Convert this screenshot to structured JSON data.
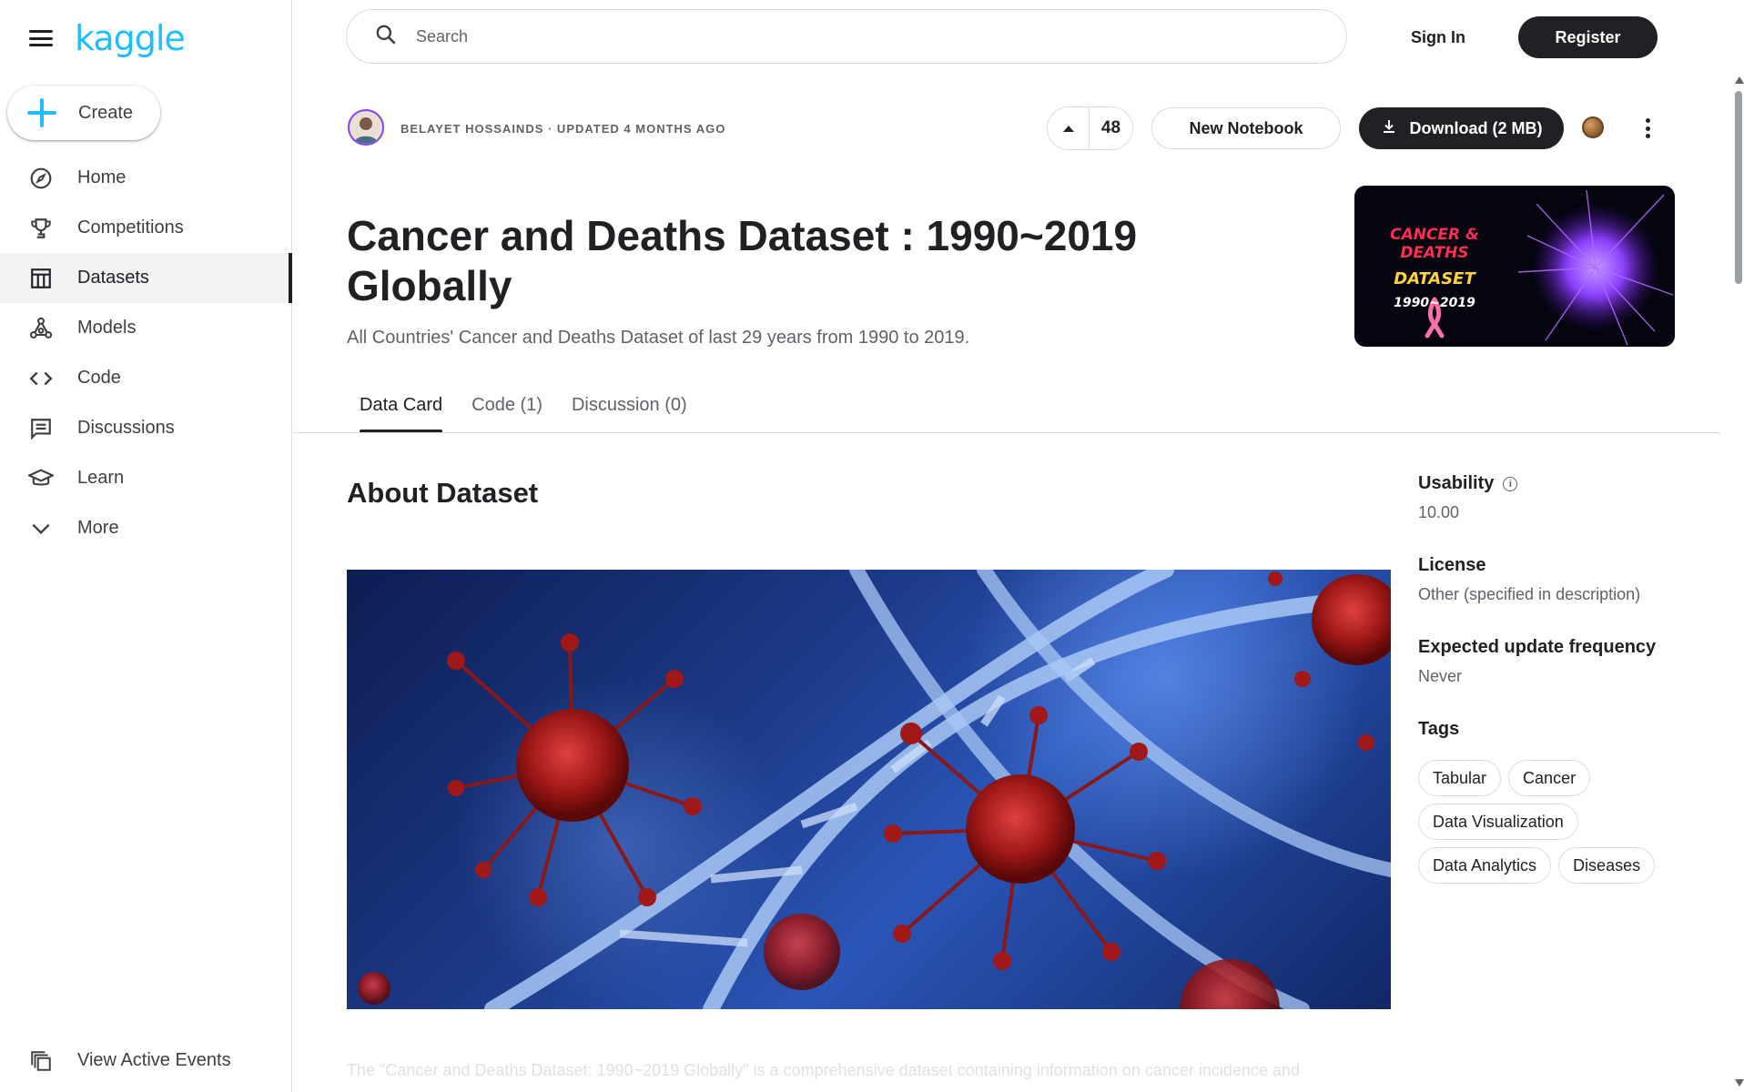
{
  "sidebar": {
    "logo": "kaggle",
    "create_label": "Create",
    "items": [
      {
        "label": "Home",
        "icon": "compass-icon"
      },
      {
        "label": "Competitions",
        "icon": "trophy-icon"
      },
      {
        "label": "Datasets",
        "icon": "table-icon",
        "active": true
      },
      {
        "label": "Models",
        "icon": "models-icon"
      },
      {
        "label": "Code",
        "icon": "code-icon"
      },
      {
        "label": "Discussions",
        "icon": "discussions-icon"
      },
      {
        "label": "Learn",
        "icon": "graduation-cap-icon"
      },
      {
        "label": "More",
        "icon": "chevron-down-icon"
      }
    ],
    "events_label": "View Active Events"
  },
  "header": {
    "search_placeholder": "Search",
    "signin_label": "Sign In",
    "register_label": "Register"
  },
  "dataset": {
    "author_line": "BELAYET HOSSAINDS · UPDATED 4 MONTHS AGO",
    "vote_count": "48",
    "new_notebook_label": "New Notebook",
    "download_label": "Download (2 MB)",
    "title": "Cancer and Deaths Dataset : 1990~2019 Globally",
    "subtitle": "All Countries' Cancer and Deaths Dataset of last 29 years from 1990 to 2019.",
    "cover": {
      "line1": "CANCER & DEATHS",
      "line2": "DATASET",
      "line3": "1990~2019"
    }
  },
  "tabs": [
    {
      "label": "Data Card",
      "active": true
    },
    {
      "label": "Code (1)"
    },
    {
      "label": "Discussion (0)"
    }
  ],
  "about": {
    "heading": "About Dataset",
    "faded_text": "The \"Cancer and Deaths Dataset: 1990~2019 Globally\" is a comprehensive dataset containing information on cancer incidence and"
  },
  "side": {
    "usability_label": "Usability",
    "usability_value": "10.00",
    "license_label": "License",
    "license_value": "Other (specified in description)",
    "frequency_label": "Expected update frequency",
    "frequency_value": "Never",
    "tags_label": "Tags",
    "tags": [
      "Tabular",
      "Cancer",
      "Data Visualization",
      "Data Analytics",
      "Diseases"
    ]
  },
  "colors": {
    "brand": "#20beff",
    "primary_dark": "#202124",
    "muted_text": "#5f6368",
    "border": "#dadce0"
  }
}
